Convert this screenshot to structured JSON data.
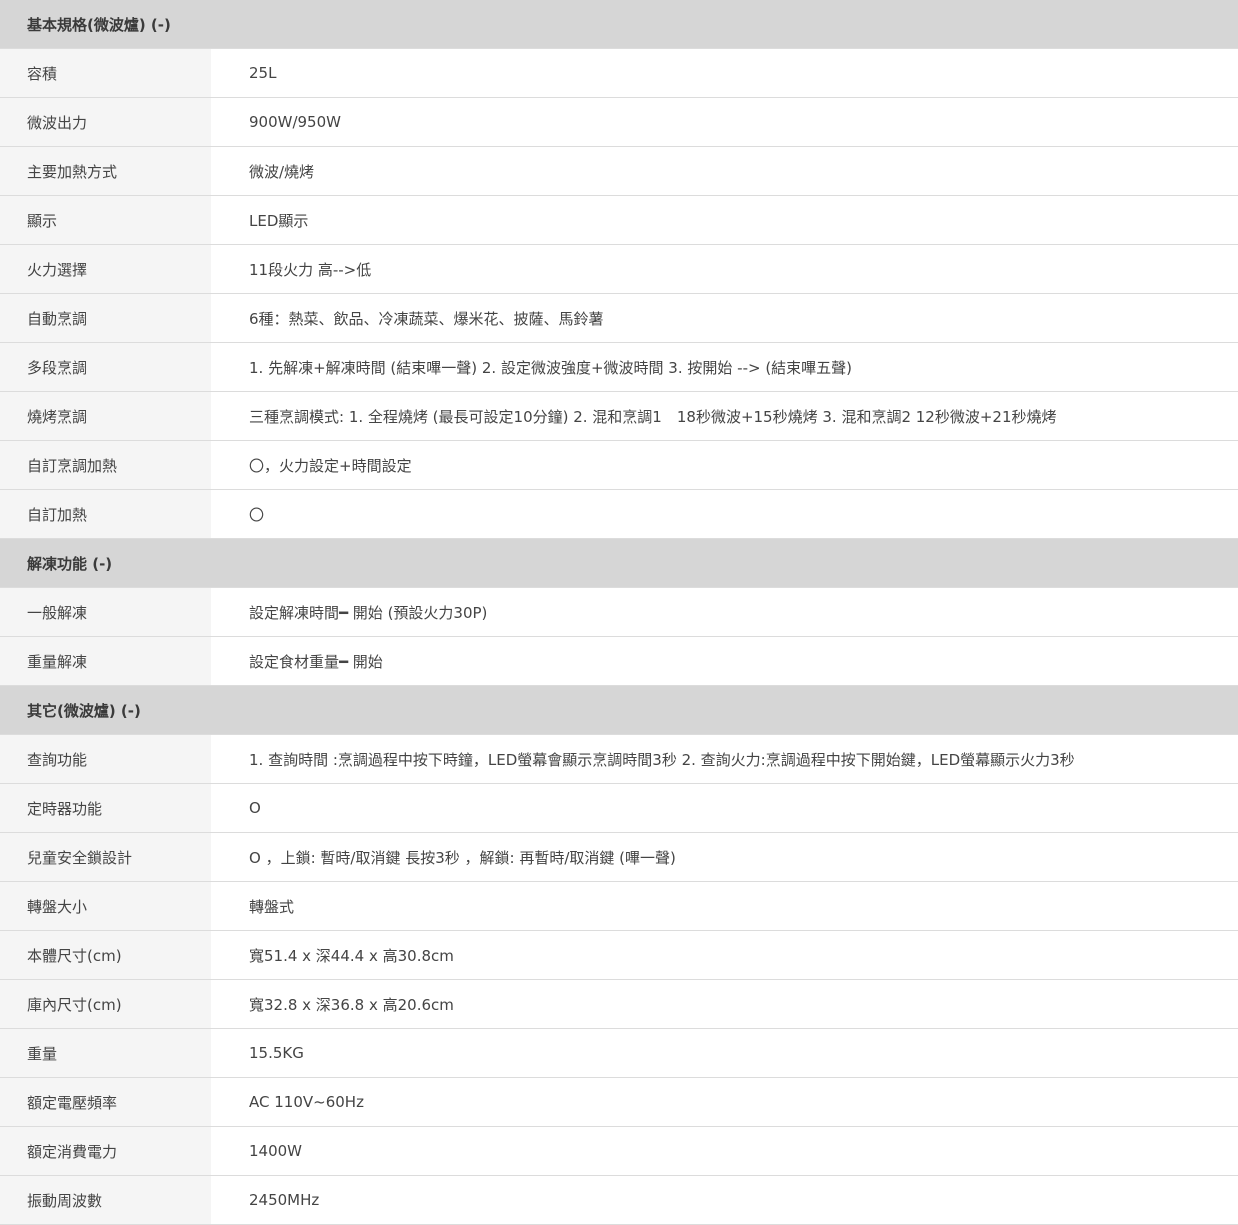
{
  "sections": [
    {
      "title": "基本規格(微波爐) (-)",
      "rows": [
        {
          "label": "容積",
          "value": "25L"
        },
        {
          "label": "微波出力",
          "value": "900W/950W"
        },
        {
          "label": "主要加熱方式",
          "value": "微波/燒烤"
        },
        {
          "label": "顯示",
          "value": "LED顯示"
        },
        {
          "label": "火力選擇",
          "value": "11段火力 高-->低"
        },
        {
          "label": "自動烹調",
          "value": "6種：熱菜、飲品、冷凍蔬菜、爆米花、披薩、馬鈴薯"
        },
        {
          "label": "多段烹調",
          "value": "1. 先解凍+解凍時間 (結束嗶一聲) 2. 設定微波強度+微波時間 3. 按開始 --> (結束嗶五聲)"
        },
        {
          "label": "燒烤烹調",
          "value": "三種烹調模式: 1. 全程燒烤 (最長可設定10分鐘) 2. 混和烹調1　18秒微波+15秒燒烤 3. 混和烹調2 12秒微波+21秒燒烤"
        },
        {
          "label": "自訂烹調加熱",
          "value": "〇，火力設定+時間設定"
        },
        {
          "label": "自訂加熱",
          "value": "〇"
        }
      ]
    },
    {
      "title": "解凍功能 (-)",
      "rows": [
        {
          "label": "一般解凍",
          "value": "設定解凍時間━ 開始 (預設火力30P)"
        },
        {
          "label": "重量解凍",
          "value": "設定食材重量━ 開始"
        }
      ]
    },
    {
      "title": "其它(微波爐) (-)",
      "rows": [
        {
          "label": "查詢功能",
          "value": "1. 查詢時間 :烹調過程中按下時鐘，LED螢幕會顯示烹調時間3秒 2. 查詢火力:烹調過程中按下開始鍵，LED螢幕顯示火力3秒"
        },
        {
          "label": "定時器功能",
          "value": "O"
        },
        {
          "label": "兒童安全鎖設計",
          "value": "O ，上鎖: 暫時/取消鍵 長按3秒 ，解鎖: 再暫時/取消鍵 (嗶一聲)"
        },
        {
          "label": "轉盤大小",
          "value": "轉盤式"
        },
        {
          "label": "本體尺寸(cm)",
          "value": "寬51.4 x 深44.4 x 高30.8cm"
        },
        {
          "label": "庫內尺寸(cm)",
          "value": "寬32.8 x 深36.8 x 高20.6cm"
        },
        {
          "label": "重量",
          "value": "15.5KG"
        },
        {
          "label": "額定電壓頻率",
          "value": "AC 110V~60Hz"
        },
        {
          "label": "額定消費電力",
          "value": "1400W"
        },
        {
          "label": "振動周波數",
          "value": "2450MHz"
        }
      ]
    }
  ]
}
